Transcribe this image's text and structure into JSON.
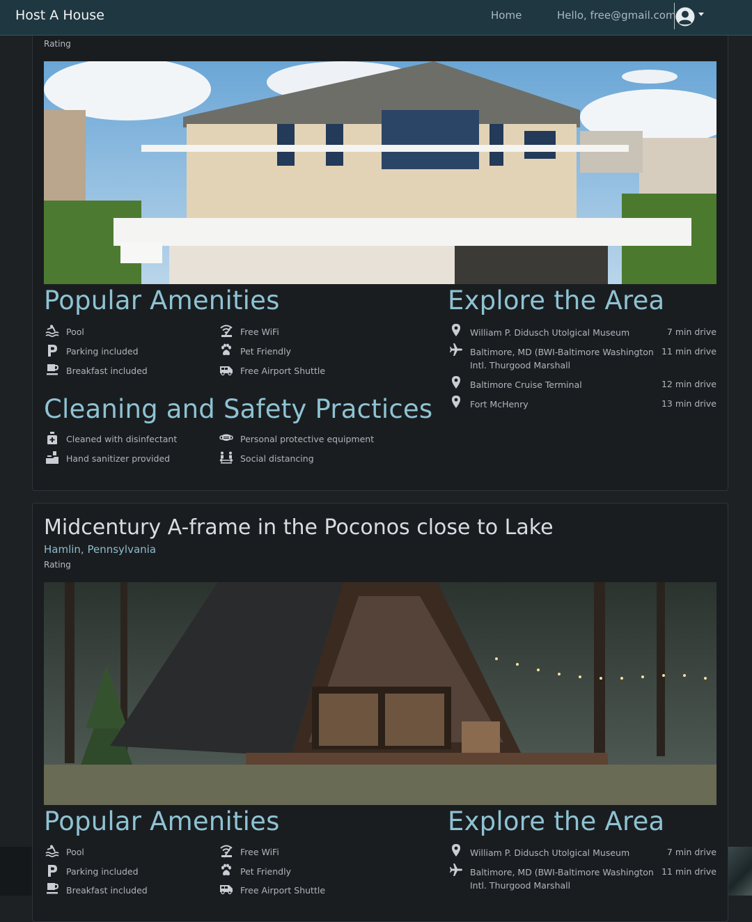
{
  "nav": {
    "brand": "Host A House",
    "home": "Home",
    "greeting": "Hello, free@gmail.com"
  },
  "listings": [
    {
      "title": "",
      "location": "",
      "rating_label": "Rating",
      "amenities_title": "Popular Amenities",
      "amenities": [
        {
          "icon": "swimmer-icon",
          "label": "Pool"
        },
        {
          "icon": "wifi-icon",
          "label": "Free WiFi"
        },
        {
          "icon": "parking-icon",
          "label": "Parking included"
        },
        {
          "icon": "paw-icon",
          "label": "Pet Friendly"
        },
        {
          "icon": "coffee-icon",
          "label": "Breakfast included"
        },
        {
          "icon": "shuttle-van-icon",
          "label": "Free Airport Shuttle"
        }
      ],
      "cleaning_title": "Cleaning and Safety Practices",
      "cleaning": [
        {
          "icon": "disinfectant-bottle-icon",
          "label": "Cleaned with disinfectant"
        },
        {
          "icon": "face-mask-icon",
          "label": "Personal protective equipment"
        },
        {
          "icon": "hand-sanitizer-icon",
          "label": "Hand sanitizer provided"
        },
        {
          "icon": "social-distancing-icon",
          "label": "Social distancing"
        }
      ],
      "explore_title": "Explore the Area",
      "places": [
        {
          "icon": "map-marker-icon",
          "name": "William P. Didusch Utolgical Museum",
          "distance": "7 min drive"
        },
        {
          "icon": "plane-icon",
          "name": "Baltimore, MD (BWI-Baltimore Washington Intl. Thurgood Marshall",
          "distance": "11 min drive"
        },
        {
          "icon": "map-marker-icon",
          "name": "Baltimore Cruise Terminal",
          "distance": "12 min drive"
        },
        {
          "icon": "map-marker-icon",
          "name": "Fort McHenry",
          "distance": "13 min drive"
        }
      ]
    },
    {
      "title": "Midcentury A-frame in the Poconos close to Lake",
      "location": "Hamlin, Pennsylvania",
      "rating_label": "Rating",
      "amenities_title": "Popular Amenities",
      "amenities": [
        {
          "icon": "swimmer-icon",
          "label": "Pool"
        },
        {
          "icon": "wifi-icon",
          "label": "Free WiFi"
        },
        {
          "icon": "parking-icon",
          "label": "Parking included"
        },
        {
          "icon": "paw-icon",
          "label": "Pet Friendly"
        },
        {
          "icon": "coffee-icon",
          "label": "Breakfast included"
        },
        {
          "icon": "shuttle-van-icon",
          "label": "Free Airport Shuttle"
        }
      ],
      "explore_title": "Explore the Area",
      "places": [
        {
          "icon": "map-marker-icon",
          "name": "William P. Didusch Utolgical Museum",
          "distance": "7 min drive"
        },
        {
          "icon": "plane-icon",
          "name": "Baltimore, MD (BWI-Baltimore Washington Intl. Thurgood Marshall",
          "distance": "11 min drive"
        }
      ]
    }
  ]
}
